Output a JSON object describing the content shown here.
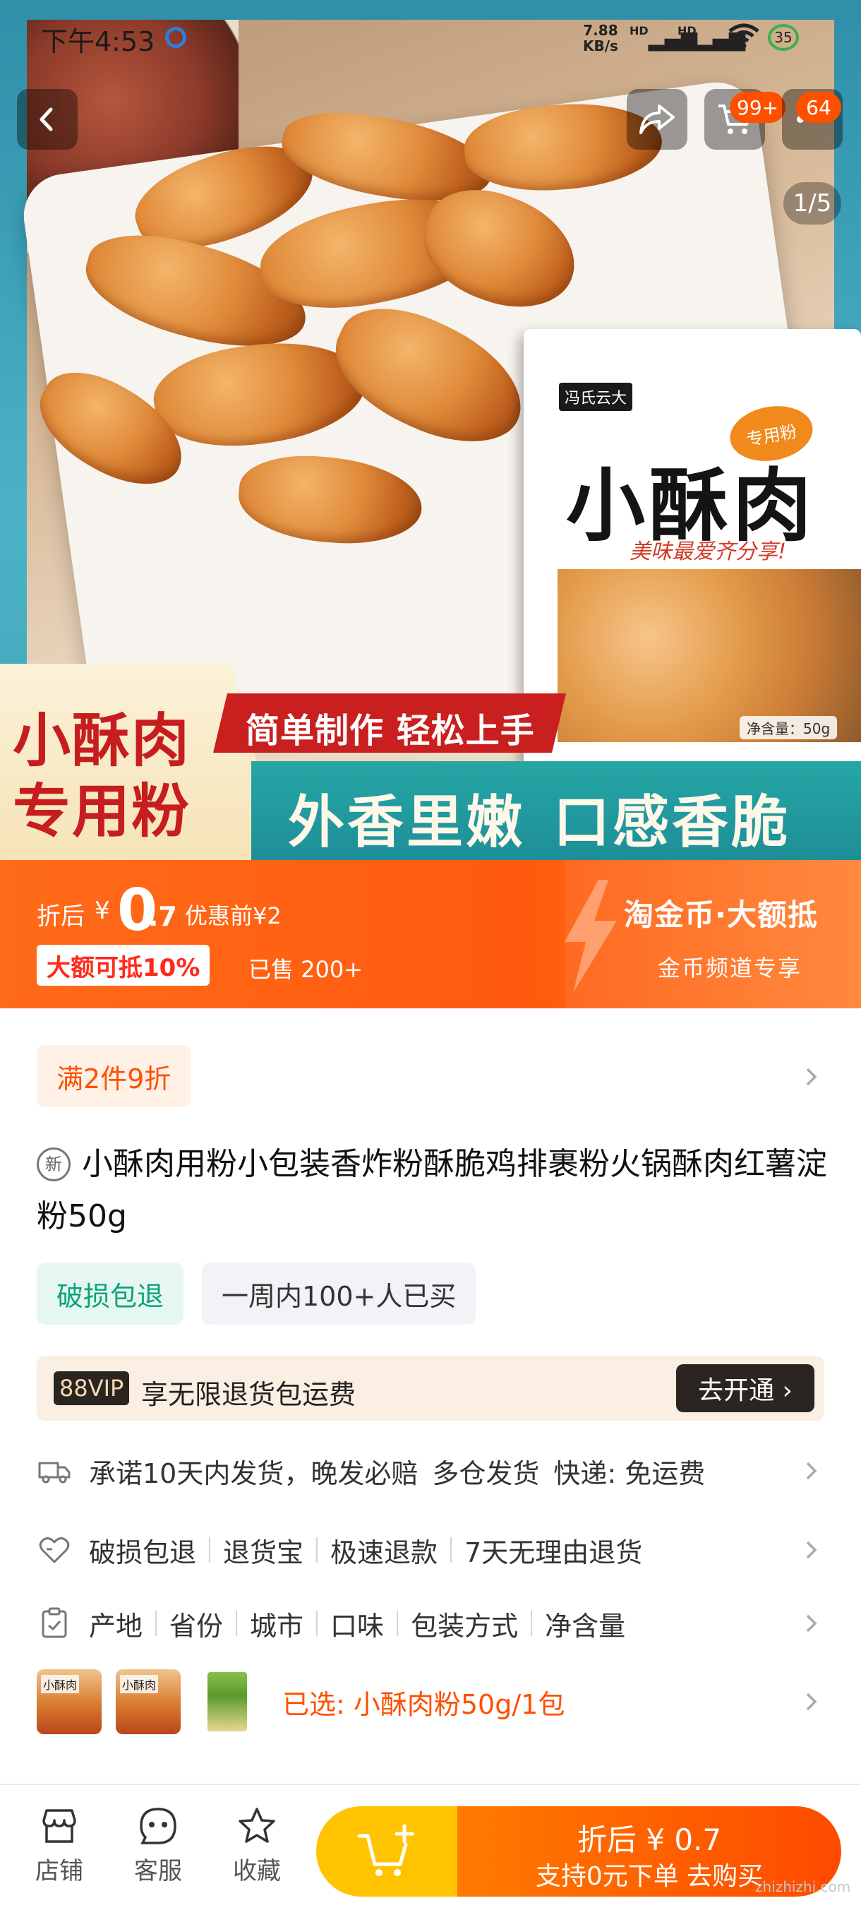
{
  "status_bar": {
    "time": "下午4:53",
    "net_speed_value": "7.88",
    "net_speed_unit": "KB/s",
    "sim1": "HD",
    "sim2": "HD",
    "battery": "35"
  },
  "hero": {
    "cart_badge": "99+",
    "more_badge": "64",
    "page_counter": "1/5",
    "package": {
      "brand": "冯氏云大",
      "badge": "专用粉",
      "title": "小酥肉",
      "slogan": "美味最爱齐分享!",
      "net": "净含量：50g"
    },
    "banner": {
      "left_line1": "小酥肉",
      "left_line2": "专用粉",
      "red": "简单制作 轻松上手",
      "teal_a": "外香里嫩",
      "teal_b": "口感香脆"
    }
  },
  "price": {
    "after_label": "折后",
    "yen": "¥",
    "int": "0",
    "dec": ".7",
    "before": "优惠前¥2",
    "tag": "大额可抵10%",
    "sold": "已售 200+",
    "coin_title": "淘金币·大额抵",
    "coin_sub": "金币频道专享"
  },
  "info": {
    "promo": "满2件9折",
    "new_tag": "新",
    "title": "小酥肉用粉小包装香炸粉酥脆鸡排裹粉火锅酥肉红薯淀粉50g",
    "chip_green": "破损包退",
    "chip_gray": "一周内100+人已买",
    "vip_logo": "88VIP",
    "vip_text": "享无限退货包运费",
    "vip_btn": "去开通 ›",
    "shipping": {
      "a": "承诺10天内发货，晚发必赔",
      "b": "多仓发货",
      "c": "快递: 免运费"
    },
    "guarantees": [
      "破损包退",
      "退货宝",
      "极速退款",
      "7天无理由退货"
    ],
    "params": [
      "产地",
      "省份",
      "城市",
      "口味",
      "包装方式",
      "净含量"
    ],
    "selected": "已选: 小酥肉粉50g/1包",
    "thumb_label": "小酥肉"
  },
  "bottom": {
    "tabs": [
      "店铺",
      "客服",
      "收藏"
    ],
    "buy_price": "折后 ¥ 0.7",
    "buy_sub": "支持0元下单  去购买"
  },
  "watermark": "zhizhizhi.com",
  "colors": {
    "accent": "#ff5000",
    "price_bar": "#ff5a0e",
    "vip_dark": "#2a2520"
  }
}
